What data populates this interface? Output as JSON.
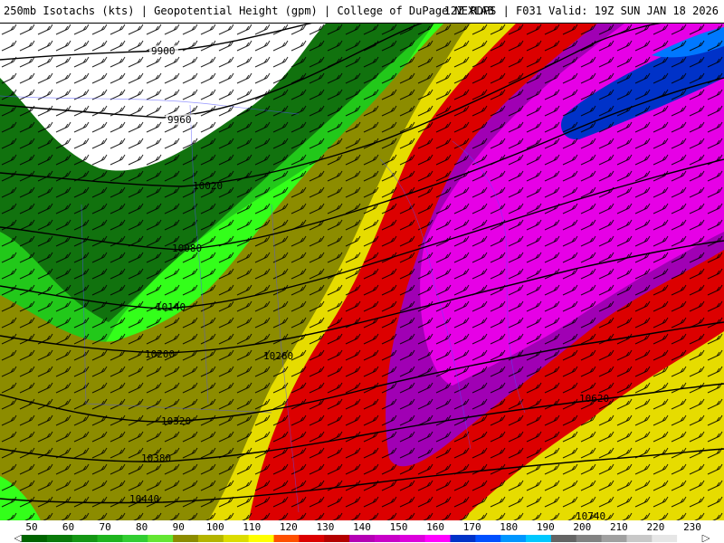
{
  "header": {
    "title_left": "250mb Isotachs (kts) | Geopotential Height (gpm) | College of DuPage NEXLAB",
    "title_right": "12Z RDPS | F031 Valid: 19Z SUN JAN 18 2026"
  },
  "contours": {
    "labels": [
      "9900",
      "9960",
      "10020",
      "10080",
      "10140",
      "10200",
      "10260",
      "10320",
      "10380",
      "10440",
      "10620",
      "10740"
    ]
  },
  "colorbar": {
    "ticks": [
      "50",
      "60",
      "70",
      "80",
      "90",
      "100",
      "110",
      "120",
      "130",
      "140",
      "150",
      "160",
      "170",
      "180",
      "190",
      "200",
      "210",
      "220",
      "230"
    ],
    "colors": [
      "#006400",
      "#0a7a0a",
      "#149614",
      "#1eb41e",
      "#32cd32",
      "#64e632",
      "#8c8c00",
      "#b4b400",
      "#dcdc00",
      "#ffff00",
      "#ff5000",
      "#dc0000",
      "#b40000",
      "#b400b4",
      "#c800c8",
      "#dc00dc",
      "#ff00ff",
      "#0032c8",
      "#0050ff",
      "#0096ff",
      "#00c8ff",
      "#646464",
      "#828282",
      "#a0a0a0",
      "#c8c8c8",
      "#e6e6e6",
      "#ffffff"
    ]
  },
  "colors": {
    "lt50": "#ffffff",
    "s50": "#11720e",
    "s70": "#22c81a",
    "s80": "#33ff1a",
    "s90": "#8c8c00",
    "s100": "#e6dc00",
    "s120": "#dc0000",
    "s130": "#c80000",
    "s150": "#a000b4",
    "s160": "#e600e6",
    "s170": "#0032c8",
    "s180": "#0078ff"
  }
}
